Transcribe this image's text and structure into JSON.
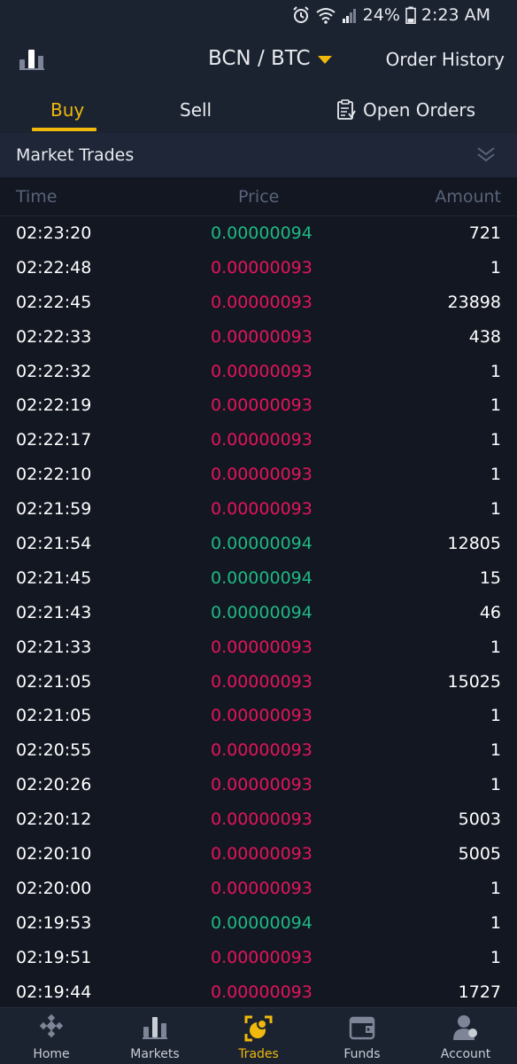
{
  "status_bar": {
    "battery": "24%",
    "time": "2:23 AM"
  },
  "header": {
    "pair": "BCN / BTC",
    "order_history": "Order History"
  },
  "tabs": {
    "buy": "Buy",
    "sell": "Sell",
    "open_orders": "Open Orders"
  },
  "market_trades": {
    "title": "Market Trades",
    "columns": {
      "time": "Time",
      "price": "Price",
      "amount": "Amount"
    },
    "rows": [
      {
        "time": "02:23:20",
        "price": "0.00000094",
        "amount": "721",
        "side": "up"
      },
      {
        "time": "02:22:48",
        "price": "0.00000093",
        "amount": "1",
        "side": "down"
      },
      {
        "time": "02:22:45",
        "price": "0.00000093",
        "amount": "23898",
        "side": "down"
      },
      {
        "time": "02:22:33",
        "price": "0.00000093",
        "amount": "438",
        "side": "down"
      },
      {
        "time": "02:22:32",
        "price": "0.00000093",
        "amount": "1",
        "side": "down"
      },
      {
        "time": "02:22:19",
        "price": "0.00000093",
        "amount": "1",
        "side": "down"
      },
      {
        "time": "02:22:17",
        "price": "0.00000093",
        "amount": "1",
        "side": "down"
      },
      {
        "time": "02:22:10",
        "price": "0.00000093",
        "amount": "1",
        "side": "down"
      },
      {
        "time": "02:21:59",
        "price": "0.00000093",
        "amount": "1",
        "side": "down"
      },
      {
        "time": "02:21:54",
        "price": "0.00000094",
        "amount": "12805",
        "side": "up"
      },
      {
        "time": "02:21:45",
        "price": "0.00000094",
        "amount": "15",
        "side": "up"
      },
      {
        "time": "02:21:43",
        "price": "0.00000094",
        "amount": "46",
        "side": "up"
      },
      {
        "time": "02:21:33",
        "price": "0.00000093",
        "amount": "1",
        "side": "down"
      },
      {
        "time": "02:21:05",
        "price": "0.00000093",
        "amount": "15025",
        "side": "down"
      },
      {
        "time": "02:21:05",
        "price": "0.00000093",
        "amount": "1",
        "side": "down"
      },
      {
        "time": "02:20:55",
        "price": "0.00000093",
        "amount": "1",
        "side": "down"
      },
      {
        "time": "02:20:26",
        "price": "0.00000093",
        "amount": "1",
        "side": "down"
      },
      {
        "time": "02:20:12",
        "price": "0.00000093",
        "amount": "5003",
        "side": "down"
      },
      {
        "time": "02:20:10",
        "price": "0.00000093",
        "amount": "5005",
        "side": "down"
      },
      {
        "time": "02:20:00",
        "price": "0.00000093",
        "amount": "1",
        "side": "down"
      },
      {
        "time": "02:19:53",
        "price": "0.00000094",
        "amount": "1",
        "side": "up"
      },
      {
        "time": "02:19:51",
        "price": "0.00000093",
        "amount": "1",
        "side": "down"
      },
      {
        "time": "02:19:44",
        "price": "0.00000093",
        "amount": "1727",
        "side": "down"
      }
    ]
  },
  "bottom_nav": {
    "home": "Home",
    "markets": "Markets",
    "trades": "Trades",
    "funds": "Funds",
    "account": "Account"
  },
  "colors": {
    "accent": "#f0b90b",
    "up": "#1fb983",
    "down": "#e2155b",
    "background": "#131722"
  }
}
